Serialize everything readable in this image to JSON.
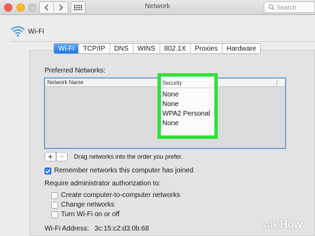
{
  "window": {
    "title": "Network"
  },
  "toolbar": {
    "search_placeholder": "Search"
  },
  "header": {
    "title": "Wi-Fi"
  },
  "tabs": [
    {
      "label": "Wi-Fi",
      "active": true
    },
    {
      "label": "TCP/IP"
    },
    {
      "label": "DNS"
    },
    {
      "label": "WINS"
    },
    {
      "label": "802.1X"
    },
    {
      "label": "Proxies"
    },
    {
      "label": "Hardware"
    }
  ],
  "preferred": {
    "title": "Preferred Networks:",
    "col_name": "Network Name",
    "col_security": "Security",
    "security_values": [
      "None",
      "None",
      "WPA2 Personal",
      "None"
    ],
    "hint": "Drag networks into the order you prefer.",
    "add_label": "+",
    "remove_label": "−"
  },
  "options": {
    "remember": "Remember networks this computer has joined",
    "remember_checked": true,
    "require_admin": "Require administrator authorization to:",
    "items": [
      {
        "label": "Create computer-to-computer networks",
        "checked": false
      },
      {
        "label": "Change networks",
        "checked": false
      },
      {
        "label": "Turn Wi-Fi on or off",
        "checked": false
      }
    ]
  },
  "address": {
    "label": "Wi-Fi Address:",
    "value": "3c:15:c2:d3:0b:68"
  },
  "watermark": {
    "wiki": "wiki",
    "how": "How"
  },
  "colors": {
    "accent": "#2d82ee",
    "highlight": "#2ee23a"
  }
}
